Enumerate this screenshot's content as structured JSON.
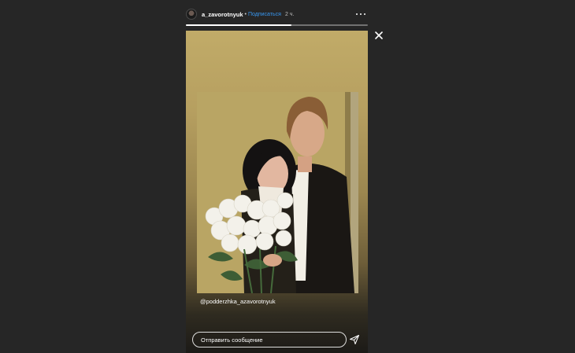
{
  "header": {
    "username": "a_zavorotnyuk",
    "separator": "•",
    "follow_label": "Подписаться",
    "time": "2 ч."
  },
  "story": {
    "progress": 0.58,
    "mention": "@podderzhka_azavorotnyuk"
  },
  "reply": {
    "placeholder": "Отправить сообщение"
  },
  "icons": {
    "more": "more-options-icon",
    "close": "close-icon",
    "send": "send-icon"
  },
  "colors": {
    "background": "#262626",
    "link": "#3897f0",
    "text": "#ffffff"
  }
}
